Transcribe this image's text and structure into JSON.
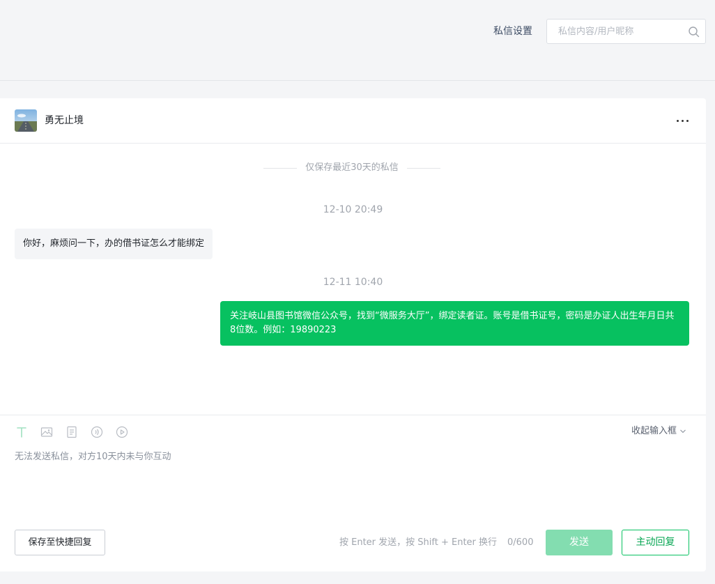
{
  "header": {
    "settings_label": "私信设置",
    "search_placeholder": "私信内容/用户昵称"
  },
  "conversation": {
    "username": "勇无止境",
    "more_icon": "more-icon",
    "retention_notice": "仅保存最近30天的私信",
    "messages": [
      {
        "timestamp": "12-10 20:49",
        "direction": "incoming",
        "text": "你好，麻烦问一下，办的借书证怎么才能绑定"
      },
      {
        "timestamp": "12-11 10:40",
        "direction": "outgoing",
        "text": "关注岐山县图书馆微信公众号，找到“微服务大厅”，绑定读者证。账号是借书证号，密码是办证人出生年月日共8位数。例如：19890223"
      }
    ]
  },
  "composer": {
    "tools": [
      "text-icon",
      "image-icon",
      "document-icon",
      "audio-icon",
      "video-icon"
    ],
    "collapse_label": "收起输入框",
    "disabled_hint": "无法发送私信，对方10天内未与你互动",
    "save_quick_label": "保存至快捷回复",
    "send_hint": "按 Enter 发送，按 Shift + Enter 换行",
    "char_count": "0/600",
    "send_label": "发送",
    "reply_label": "主动回复"
  },
  "colors": {
    "accent": "#07c160",
    "accent_disabled": "#83ddb0",
    "page_bg": "#f4f5f7"
  }
}
